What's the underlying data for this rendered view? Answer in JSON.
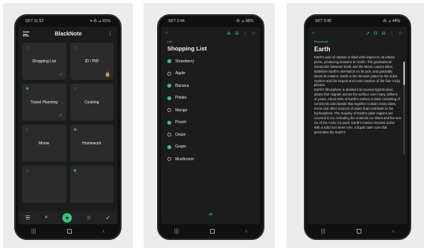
{
  "colors": {
    "accent": "#2ecc71",
    "screen_bg": "#1c1c1c",
    "card_bg": "#2b2b2b"
  },
  "phone1": {
    "status_time": "SKT 11:52",
    "status_right": "▾ ⁂ ⊿ 81%",
    "app_title": "BlackNote",
    "menu_icon": "hamburger-icon",
    "more_icon": "more-vert-icon",
    "cards": [
      {
        "label": "Shopping List",
        "starred": false,
        "mark": "✓"
      },
      {
        "label": "ID / PW",
        "starred": false,
        "mark": "🔒"
      },
      {
        "label": "Travel Planning",
        "starred": true,
        "mark": "✓"
      },
      {
        "label": "Cooking",
        "starred": false,
        "mark": ""
      },
      {
        "label": "Movie",
        "starred": false,
        "mark": ""
      },
      {
        "label": "Homework",
        "starred": true,
        "mark": ""
      },
      {
        "label": "",
        "starred": false,
        "mark": ""
      },
      {
        "label": "",
        "starred": true,
        "mark": ""
      }
    ],
    "bottom_bar": {
      "menu": "☰",
      "search": "⌕",
      "add": "+",
      "star": "☆",
      "check": "✓"
    }
  },
  "phone2": {
    "status_time": "SKT 3:44",
    "status_right": "⁂ ⊿ 45%",
    "back_icon": "back-icon",
    "toolbar_icons": [
      "⊕",
      "⊟",
      "⋮",
      "☆"
    ],
    "breadcrumb": "Life",
    "list_title": "Shopping List",
    "items": [
      {
        "text": "Strawberry",
        "checked": true
      },
      {
        "text": "Apple",
        "checked": false
      },
      {
        "text": "Banana",
        "checked": true
      },
      {
        "text": "Potato",
        "checked": true
      },
      {
        "text": "Mango",
        "checked": false
      },
      {
        "text": "Peach",
        "checked": true
      },
      {
        "text": "Onion",
        "checked": false
      },
      {
        "text": "Grape",
        "checked": true
      },
      {
        "text": "Mushroom",
        "checked": false
      }
    ],
    "add_label": "+"
  },
  "phone3": {
    "status_time": "SKT 3:45",
    "status_right": "⁂ ⊿ 44%",
    "back_icon": "back-icon",
    "toolbar_icons": [
      "➚",
      "⊡",
      "⊟",
      "⋮",
      "☆"
    ],
    "breadcrumb": "BlackNote",
    "doc_title": "Earth",
    "doc_body": "Earth's axis of rotation is tilted with respect to its orbital plane, producing seasons on Earth. The gravitational interaction between Earth and the Moon causes tides, stabilizes Earth's orientation on its axis, and gradually slows its rotation. Earth is the densest planet in the Solar System and the largest and most massive of the four rocky planets.\nEarth's lithosphere is divided into several rigid tectonic plates that migrate across the surface over many millions of years. About 29% of Earth's surface is land consisting of continents and islands that together contain many lakes, rivers and other sources of water that contribute to the hydrosphere. The majority of Earth's polar regions are covered in ice, including the Antarctic ice sheet and the sea ice of the Arctic ice pack. Earth's interior remains active with a solid iron inner core, a liquid outer core that generates the Earth's"
  },
  "nav_bar": {
    "recents": "|||",
    "home": "□",
    "back": "‹"
  }
}
